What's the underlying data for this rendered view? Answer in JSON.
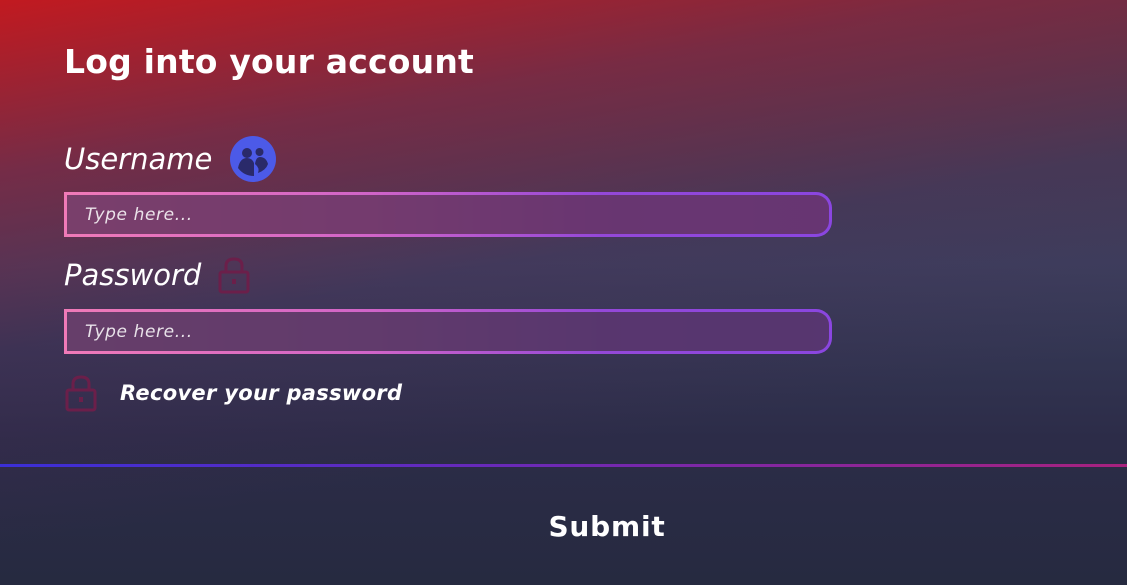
{
  "form": {
    "title": "Log into your account",
    "username": {
      "label": "Username",
      "icon": "user-avatar-icon",
      "placeholder": "Type here..."
    },
    "password": {
      "label": "Password",
      "icon": "lock-icon",
      "placeholder": "Type here..."
    },
    "recover": {
      "icon": "lock-icon",
      "label": "Recover your password"
    },
    "submit_label": "Submit"
  },
  "colors": {
    "accent_pink": "#f07ab8",
    "accent_purple": "#8a46e0",
    "avatar_blue": "#4c5ae8",
    "lock_maroon": "#6b1f4a",
    "divider_blue": "#3b2fd6",
    "divider_magenta": "#a8227e",
    "header_red": "#c8181e",
    "background_navy": "#262a40"
  }
}
